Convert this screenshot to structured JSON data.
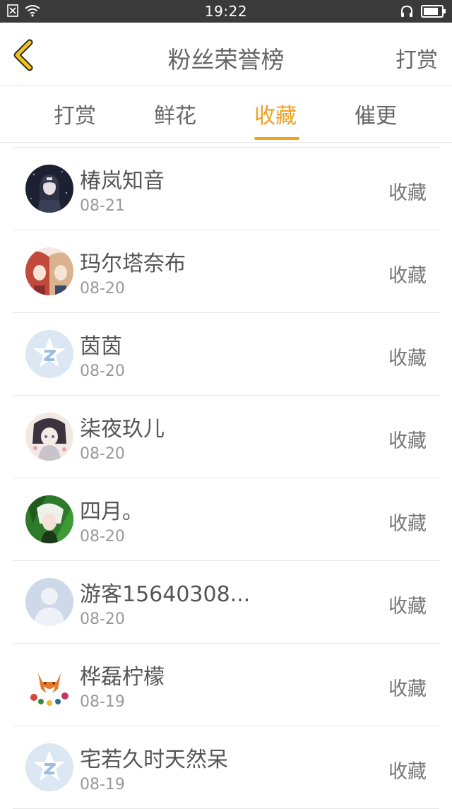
{
  "status_bar": {
    "time": "19:22"
  },
  "nav": {
    "title": "粉丝荣誉榜",
    "action": "打赏"
  },
  "tabs": [
    {
      "label": "打赏"
    },
    {
      "label": "鲜花"
    },
    {
      "label": "收藏"
    },
    {
      "label": "催更"
    }
  ],
  "active_tab": "收藏",
  "accent_color": "#f0a020",
  "rows": [
    {
      "name": "椿岚知音",
      "date": "08-21",
      "action": "收藏",
      "avatar": "anime-dark"
    },
    {
      "name": "玛尔塔奈布",
      "date": "08-20",
      "action": "收藏",
      "avatar": "anime-pair"
    },
    {
      "name": "茵茵",
      "date": "08-20",
      "action": "收藏",
      "avatar": "qq-default"
    },
    {
      "name": "柒夜玖儿",
      "date": "08-20",
      "action": "收藏",
      "avatar": "anime-girl"
    },
    {
      "name": "四月。",
      "date": "08-20",
      "action": "收藏",
      "avatar": "anime-green"
    },
    {
      "name": "游客15640308...",
      "date": "08-20",
      "action": "收藏",
      "avatar": "guest-default"
    },
    {
      "name": "桦磊柠檬",
      "date": "08-19",
      "action": "收藏",
      "avatar": "fox"
    },
    {
      "name": "宅若久时天然呆",
      "date": "08-19",
      "action": "收藏",
      "avatar": "qq-default"
    }
  ]
}
